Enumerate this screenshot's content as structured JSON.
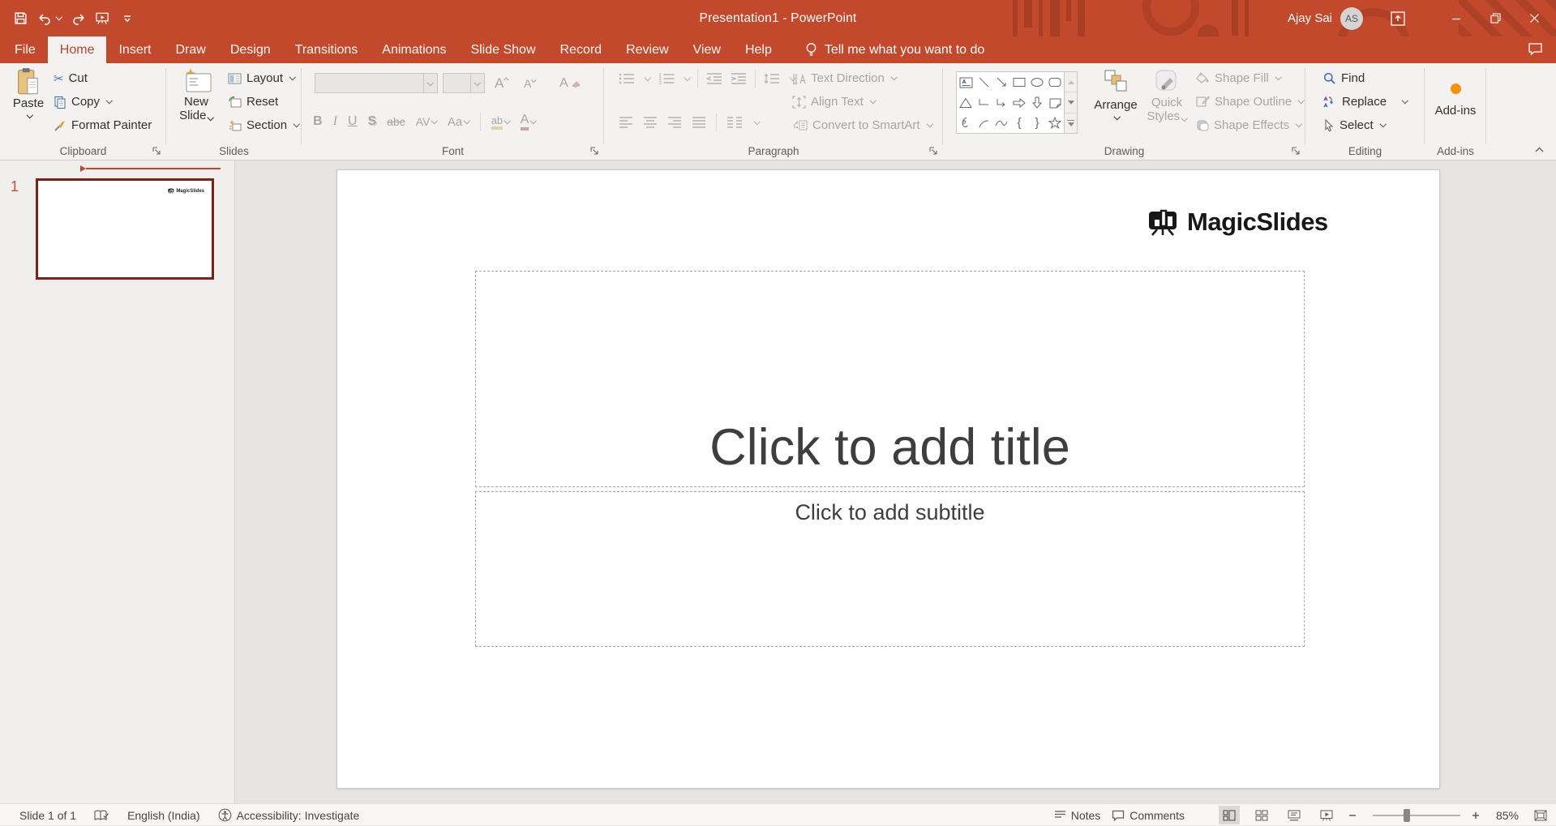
{
  "window": {
    "title": "Presentation1  -  PowerPoint",
    "user_name": "Ajay Sai",
    "avatar_initials": "AS"
  },
  "tabs": {
    "file": "File",
    "home": "Home",
    "insert": "Insert",
    "draw": "Draw",
    "design": "Design",
    "transitions": "Transitions",
    "animations": "Animations",
    "slide_show": "Slide Show",
    "record": "Record",
    "review": "Review",
    "view": "View",
    "help": "Help",
    "tell_me": "Tell me what you want to do"
  },
  "ribbon": {
    "clipboard": {
      "group_label": "Clipboard",
      "paste": "Paste",
      "cut": "Cut",
      "copy": "Copy",
      "format_painter": "Format Painter"
    },
    "slides": {
      "group_label": "Slides",
      "new_line1": "New",
      "new_line2": "Slide",
      "layout": "Layout",
      "reset": "Reset",
      "section": "Section"
    },
    "font": {
      "group_label": "Font",
      "bold": "B",
      "italic": "I",
      "underline": "U",
      "shadow": "S",
      "strikethrough": "abc",
      "char_spacing": "AV",
      "change_case": "Aa",
      "grow": "A",
      "shrink": "A",
      "clear": "A",
      "highlight_ab": "ab",
      "font_color_a": "A"
    },
    "paragraph": {
      "group_label": "Paragraph",
      "text_direction": "Text Direction",
      "align_text": "Align Text",
      "convert_smartart": "Convert to SmartArt"
    },
    "drawing": {
      "group_label": "Drawing",
      "arrange": "Arrange",
      "quick_line1": "Quick",
      "quick_line2": "Styles",
      "shape_fill": "Shape Fill",
      "shape_outline": "Shape Outline",
      "shape_effects": "Shape Effects"
    },
    "editing": {
      "group_label": "Editing",
      "find": "Find",
      "replace": "Replace",
      "select": "Select"
    },
    "addins": {
      "group_label": "Add-ins",
      "button_label": "Add-ins"
    }
  },
  "icon_glyphs": {
    "scissors": "✂",
    "left_brace": "{",
    "right_brace": "}"
  },
  "shape_gallery_names": [
    "text-box",
    "line",
    "arrow",
    "rectangle",
    "oval",
    "rounded-rectangle",
    "triangle",
    "elbow-connector",
    "elbow-arrow-connector",
    "right-arrow",
    "down-arrow",
    "folded-corner",
    "scribble",
    "arc",
    "curve",
    "left-brace",
    "right-brace",
    "star"
  ],
  "slide_panel": {
    "slide_number": "1"
  },
  "slide": {
    "logo_text": "MagicSlides",
    "title_placeholder": "Click to add title",
    "subtitle_placeholder": "Click to add subtitle"
  },
  "statusbar": {
    "slide_indicator": "Slide 1 of 1",
    "language": "English (India)",
    "accessibility": "Accessibility: Investigate",
    "notes": "Notes",
    "comments": "Comments",
    "zoom_level": "85%"
  },
  "colors": {
    "accent": "#C2492B",
    "thumb_border": "#7D201A",
    "ribbon_bg": "#F4F2F0"
  }
}
